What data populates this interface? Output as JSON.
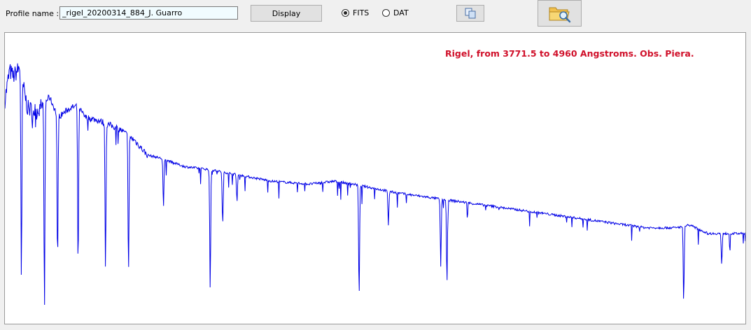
{
  "toolbar": {
    "profile_label": "Profile name :",
    "profile_value": "_rigel_20200314_884_J. Guarro",
    "display_label": "Display",
    "format_options": [
      {
        "label": "FITS",
        "selected": true
      },
      {
        "label": "DAT",
        "selected": false
      }
    ],
    "copy_icon": "copy-icon",
    "open_icon": "folder-search-icon"
  },
  "plot": {
    "title": "Rigel, from 3771.5 to 4960 Angstroms.  Obs. Piera.",
    "line_color": "#0000e6",
    "title_color": "#d0102a"
  },
  "chart_data": {
    "type": "line",
    "title": "Rigel, from 3771.5 to 4960 Angstroms.  Obs. Piera.",
    "xlabel": "",
    "ylabel": "",
    "xlim": [
      3771.5,
      4960
    ],
    "ylim": [
      0,
      1
    ],
    "grid": false,
    "continuum": [
      {
        "x": 3771.5,
        "y": 0.77
      },
      {
        "x": 3779,
        "y": 0.87
      },
      {
        "x": 3785,
        "y": 0.85
      },
      {
        "x": 3795,
        "y": 0.88
      },
      {
        "x": 3808,
        "y": 0.74
      },
      {
        "x": 3822,
        "y": 0.73
      },
      {
        "x": 3835,
        "y": 0.76
      },
      {
        "x": 3843,
        "y": 0.78
      },
      {
        "x": 3857,
        "y": 0.71
      },
      {
        "x": 3875,
        "y": 0.74
      },
      {
        "x": 3888,
        "y": 0.75
      },
      {
        "x": 3900,
        "y": 0.71
      },
      {
        "x": 3920,
        "y": 0.7
      },
      {
        "x": 3955,
        "y": 0.67
      },
      {
        "x": 3980,
        "y": 0.63
      },
      {
        "x": 4000,
        "y": 0.58
      },
      {
        "x": 4020,
        "y": 0.57
      },
      {
        "x": 4060,
        "y": 0.54
      },
      {
        "x": 4100,
        "y": 0.53
      },
      {
        "x": 4150,
        "y": 0.51
      },
      {
        "x": 4200,
        "y": 0.49
      },
      {
        "x": 4260,
        "y": 0.48
      },
      {
        "x": 4300,
        "y": 0.49
      },
      {
        "x": 4330,
        "y": 0.48
      },
      {
        "x": 4400,
        "y": 0.45
      },
      {
        "x": 4500,
        "y": 0.42
      },
      {
        "x": 4600,
        "y": 0.39
      },
      {
        "x": 4700,
        "y": 0.36
      },
      {
        "x": 4800,
        "y": 0.33
      },
      {
        "x": 4850,
        "y": 0.33
      },
      {
        "x": 4870,
        "y": 0.34
      },
      {
        "x": 4900,
        "y": 0.31
      },
      {
        "x": 4960,
        "y": 0.31
      }
    ],
    "absorption_lines": [
      {
        "x": 3798,
        "y": 0.14
      },
      {
        "x": 3835,
        "y": 0.05
      },
      {
        "x": 3856,
        "y": 0.2
      },
      {
        "x": 3889,
        "y": 0.19
      },
      {
        "x": 3933,
        "y": 0.19
      },
      {
        "x": 3970,
        "y": 0.18
      },
      {
        "x": 4026,
        "y": 0.4
      },
      {
        "x": 4101,
        "y": 0.12
      },
      {
        "x": 4121,
        "y": 0.34
      },
      {
        "x": 4144,
        "y": 0.42
      },
      {
        "x": 4340,
        "y": 0.09
      },
      {
        "x": 4387,
        "y": 0.34
      },
      {
        "x": 4471,
        "y": 0.2
      },
      {
        "x": 4481,
        "y": 0.14
      },
      {
        "x": 4861,
        "y": 0.09
      },
      {
        "x": 4922,
        "y": 0.2
      }
    ]
  }
}
